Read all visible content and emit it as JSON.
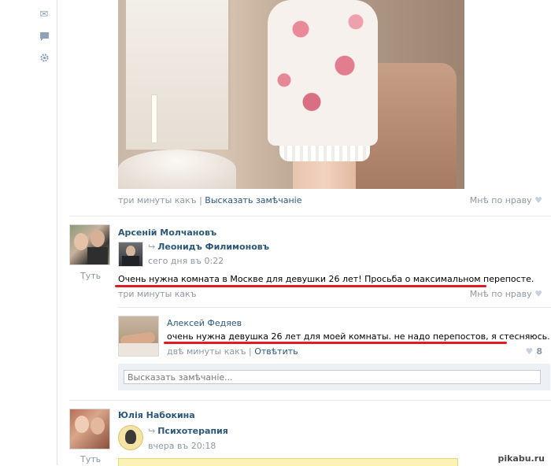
{
  "sidebar": {
    "icons": [
      {
        "name": "mail-icon",
        "glyph": "✉"
      },
      {
        "name": "chat-icon",
        "glyph": "▀"
      },
      {
        "name": "gear-icon",
        "glyph": "✲"
      }
    ]
  },
  "post1": {
    "time": "три минуты какъ",
    "separator": "|",
    "comment_link": "Высказать замѣчаніе",
    "like_label": "Мнѣ по нраву",
    "like_icon": "♥"
  },
  "post2": {
    "author": "Арсеній Молчановъ",
    "reposted_from": "Леонидъ Филимоновъ",
    "repost_icon": "↪",
    "repost_time": "сего дня въ 0:22",
    "avatar_label": "Туть",
    "text": "Очень нужна комната в Москве для девушки 26 лет! Просьба о максимальном перепосте.",
    "time": "три минуты какъ",
    "like_label": "Мнѣ по нраву",
    "like_icon": "♥",
    "comment": {
      "author": "Алексей Федяев",
      "text": "очень нужна девушка 26 лет для моей комнаты. не надо перепостов, я стесняюсь.",
      "time": "двѣ минуты какъ",
      "separator": "|",
      "reply_link": "Отвѣтить",
      "likes": "8",
      "like_icon": "♥"
    },
    "comment_placeholder": "Высказать замѣчаніе..."
  },
  "post3": {
    "author": "Юлія Набокина",
    "reposted_from": "Психотерапия",
    "repost_icon": "↪",
    "repost_time": "вчера въ 20:18",
    "avatar_label": "Туть"
  },
  "watermark": "pikabu.ru"
}
